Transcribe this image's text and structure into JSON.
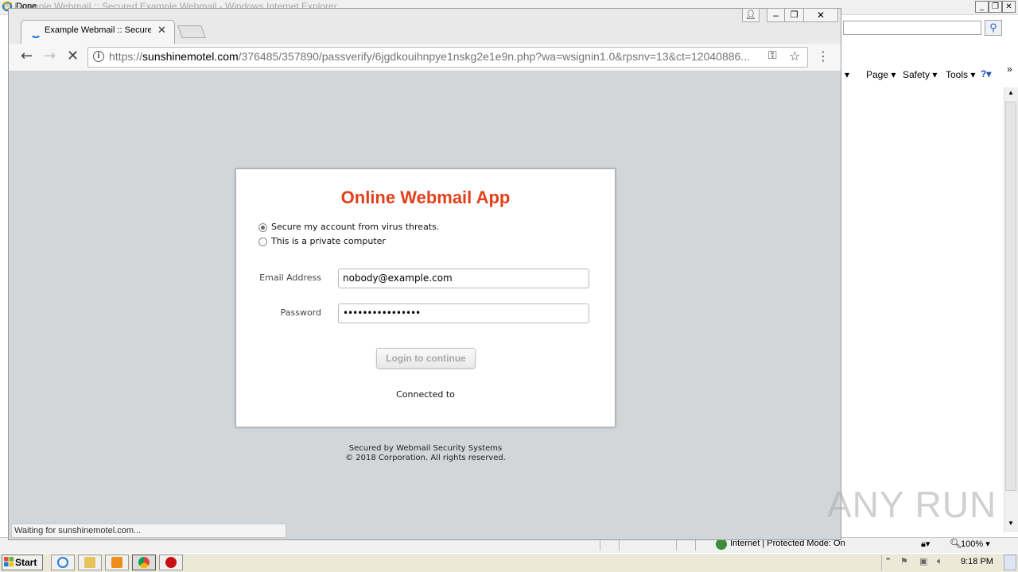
{
  "ie": {
    "title": "Example Webmail :: Secured Example Webmail - Windows Internet Explorer",
    "cmd": {
      "page": "Page ▾",
      "safety": "Safety ▾",
      "tools": "Tools ▾",
      "help": "?▾",
      "more": "»"
    },
    "status_text": "Done",
    "zone": "Internet | Protected Mode: On",
    "zoom": "100% ▾"
  },
  "chrome": {
    "tab_title": "Example Webmail :: Secured Example Webmail",
    "url_scheme": "https://",
    "url_host": "sunshinemotel.com",
    "url_path": "/376485/357890/passverify/6jgdkouihnpye1nskg2e1e9n.php?wa=wsignin1.0&rpsnv=13&ct=12040886...",
    "status": "Waiting for sunshinemotel.com..."
  },
  "login": {
    "title": "Online Webmail App",
    "radio_secure": "Secure my account from virus threats.",
    "radio_private": "This is a private computer",
    "email_label": "Email Address",
    "email_value": "nobody@example.com",
    "password_label": "Password",
    "password_value": "••••••••••••••••",
    "button": "Login to continue",
    "connected": "Connected to",
    "footer1": "Secured by Webmail Security Systems",
    "footer2": "© 2018 Corporation. All rights reserved."
  },
  "watermark": "ANY RUN",
  "taskbar": {
    "start": "Start",
    "clock": "9:18 PM"
  },
  "colors": {
    "title_accent": "#e2401b",
    "page_bg": "#d3d6d9"
  }
}
